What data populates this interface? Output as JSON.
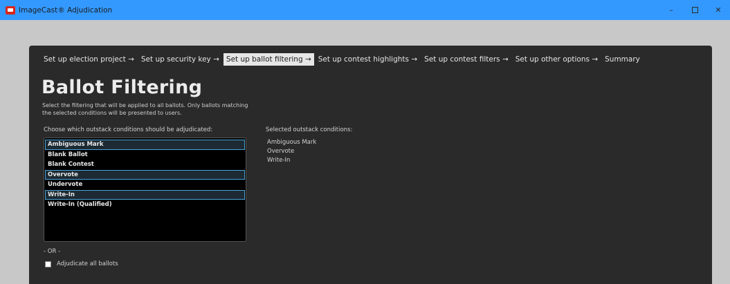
{
  "window": {
    "title": "ImageCast® Adjudication",
    "controls": {
      "minimize": "–",
      "close": "✕"
    }
  },
  "wizard": {
    "steps": [
      {
        "label": "Set up election project →",
        "active": false
      },
      {
        "label": "Set up security key →",
        "active": false
      },
      {
        "label": "Set up ballot filtering →",
        "active": true
      },
      {
        "label": "Set up contest highlights →",
        "active": false
      },
      {
        "label": "Set up contest filters →",
        "active": false
      },
      {
        "label": "Set up other options →",
        "active": false
      },
      {
        "label": "Summary",
        "active": false
      }
    ]
  },
  "page": {
    "heading": "Ballot Filtering",
    "description": "Select the filtering that will be applied to all ballots. Only ballots matching the selected conditions will be presented to users."
  },
  "conditions": {
    "choose_label": "Choose which outstack conditions should be adjudicated:",
    "items": [
      {
        "label": "Ambiguous Mark",
        "selected": true
      },
      {
        "label": "Blank Ballot",
        "selected": false
      },
      {
        "label": "Blank Contest",
        "selected": false
      },
      {
        "label": "Overvote",
        "selected": true
      },
      {
        "label": "Undervote",
        "selected": false
      },
      {
        "label": "Write-In",
        "selected": true
      },
      {
        "label": "Write-In (Qualified)",
        "selected": false
      }
    ]
  },
  "selected": {
    "label": "Selected outstack conditions:",
    "items": [
      "Ambiguous Mark",
      "Overvote",
      "Write-In"
    ]
  },
  "alternative": {
    "or_label": "- OR -",
    "adjudicate_all_label": "Adjudicate all ballots",
    "adjudicate_all_checked": false
  }
}
